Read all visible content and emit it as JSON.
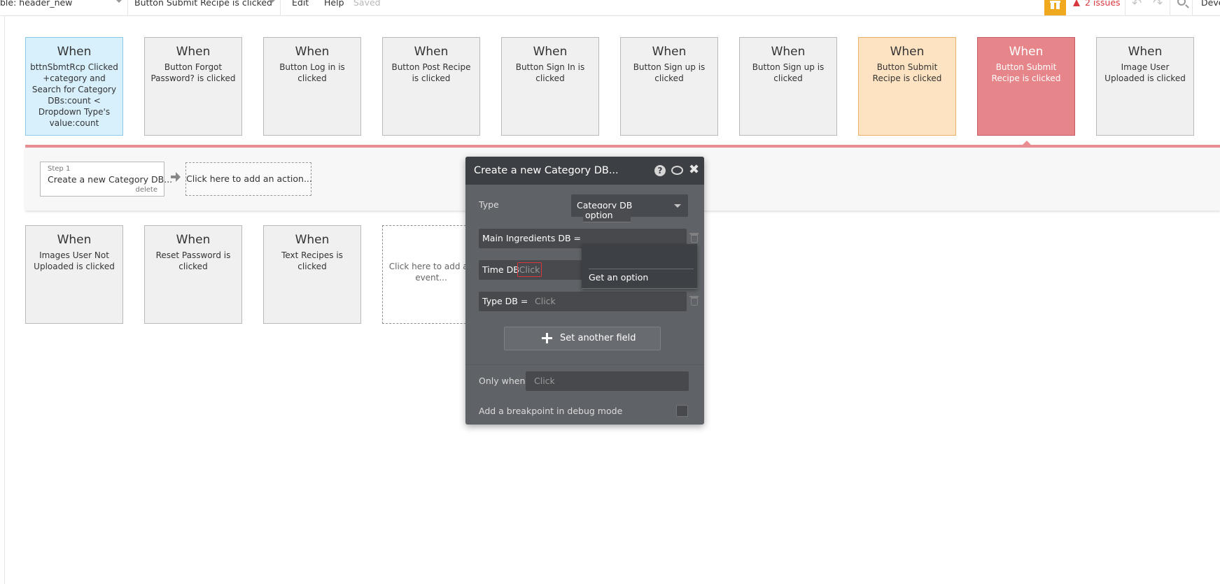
{
  "topbar": {
    "page_dropdown": "ble: header_new",
    "event_dropdown": "Button Submit Recipe is clicked",
    "menu_edit": "Edit",
    "menu_help": "Help",
    "saved_status": "Saved",
    "issues_label": "2 issues",
    "right_cut_label": "Deve",
    "icons": [
      "gift-icon",
      "warning-icon",
      "undo-icon",
      "redo-icon",
      "search-icon"
    ]
  },
  "events_row1": [
    {
      "when": "When",
      "desc": "bttnSbmtRcp Clicked +category and Search for Category DBs:count < Dropdown Type's value:count"
    },
    {
      "when": "When",
      "desc": "Button Forgot Password? is clicked"
    },
    {
      "when": "When",
      "desc": "Button Log in is clicked"
    },
    {
      "when": "When",
      "desc": "Button Post Recipe is clicked"
    },
    {
      "when": "When",
      "desc": "Button Sign In is clicked"
    },
    {
      "when": "When",
      "desc": "Button Sign up is clicked"
    },
    {
      "when": "When",
      "desc": "Button Sign up is clicked"
    },
    {
      "when": "When",
      "desc": "Button Submit Recipe is clicked"
    },
    {
      "when": "When",
      "desc": "Button Submit Recipe is clicked"
    },
    {
      "when": "When",
      "desc": "Image User Uploaded is clicked"
    }
  ],
  "events_row2": [
    {
      "when": "When",
      "desc": "Images User Not Uploaded is clicked"
    },
    {
      "when": "When",
      "desc": "Reset Password is clicked"
    },
    {
      "when": "When",
      "desc": "Text Recipes is clicked"
    }
  ],
  "add_event_label": "Click here to add an event...",
  "workflow": {
    "step_number": "Step 1",
    "step_title": "Create a new Category DB...",
    "step_delete": "delete",
    "add_action_label": "Click here to add an action..."
  },
  "modal": {
    "title": "Create a new Category DB...",
    "type_label": "Type",
    "type_value": "Category DB",
    "fields": [
      {
        "label": "Main Ingredients DB  =",
        "value": "option"
      },
      {
        "label": "Time DB",
        "value": "Click"
      },
      {
        "label": "Type DB  =",
        "value": "Click"
      }
    ],
    "dropdown_option": "Get an option",
    "set_field_button": "Set another field",
    "only_when_label": "Only when",
    "only_when_value": "Click",
    "breakpoint_label": "Add a breakpoint in debug mode"
  },
  "colors": {
    "selected_event": "#e7868a",
    "highlight_event": "#fde3c2",
    "condition_event": "#d7f0fc",
    "modal_bg": "#5f6266",
    "issues": "#d9363e",
    "gift": "#f0a81e"
  }
}
